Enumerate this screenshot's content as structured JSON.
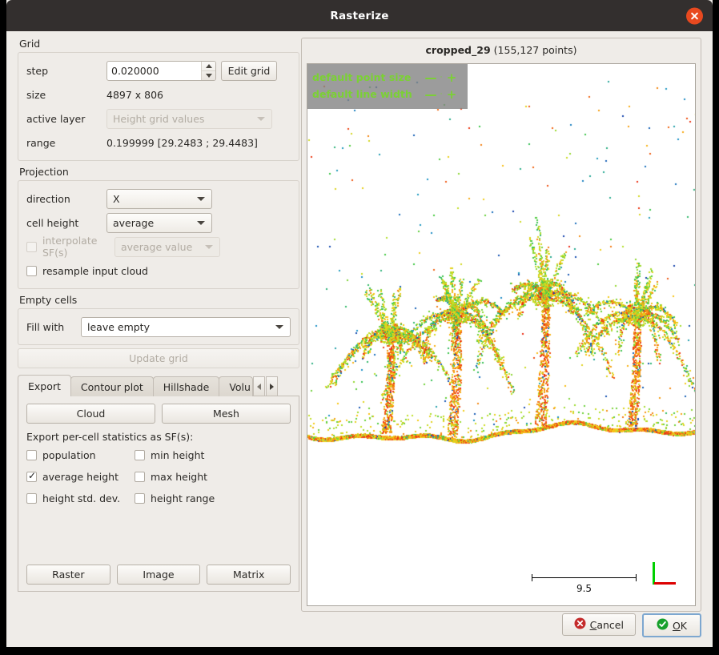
{
  "window": {
    "title": "Rasterize",
    "close_icon": "close-icon"
  },
  "grid": {
    "group_label": "Grid",
    "step_label": "step",
    "step_value": "0.020000",
    "edit_grid_label": "Edit grid",
    "size_label": "size",
    "size_value": "4897 x 806",
    "active_layer_label": "active layer",
    "active_layer_value": "Height grid values",
    "range_label": "range",
    "range_value": "0.199999 [29.2483 ; 29.4483]"
  },
  "projection": {
    "group_label": "Projection",
    "direction_label": "direction",
    "direction_value": "X",
    "cell_height_label": "cell height",
    "cell_height_value": "average",
    "interpolate_label": "interpolate SF(s)",
    "interpolate_value": "average value",
    "resample_label": "resample input cloud"
  },
  "empty_cells": {
    "group_label": "Empty cells",
    "fill_with_label": "Fill with",
    "fill_with_value": "leave empty"
  },
  "update_grid_label": "Update grid",
  "tabs": {
    "items": [
      {
        "label": "Export"
      },
      {
        "label": "Contour plot"
      },
      {
        "label": "Hillshade"
      },
      {
        "label": "Volu"
      }
    ],
    "active_index": 0,
    "scroll_left_icon": "chevron-left-icon",
    "scroll_right_icon": "chevron-right-icon"
  },
  "export_tab": {
    "cloud_label": "Cloud",
    "mesh_label": "Mesh",
    "stats_label": "Export per-cell statistics as SF(s):",
    "checkboxes": [
      {
        "label": "population",
        "checked": false
      },
      {
        "label": "min height",
        "checked": false
      },
      {
        "label": "average height",
        "checked": true
      },
      {
        "label": "max height",
        "checked": false
      },
      {
        "label": "height std. dev.",
        "checked": false
      },
      {
        "label": "height range",
        "checked": false
      }
    ],
    "bottom_buttons": [
      {
        "label": "Raster"
      },
      {
        "label": "Image"
      },
      {
        "label": "Matrix"
      }
    ]
  },
  "viewer": {
    "cloud_name": "cropped_29",
    "point_count_text": "(155,127 points)",
    "overlay": [
      {
        "label": "default point size",
        "minus": "—",
        "dot": "·",
        "plus": "+"
      },
      {
        "label": "default line width",
        "minus": "—",
        "dot": "·",
        "plus": "+"
      }
    ],
    "scale_value": "9.5",
    "axis_colors": {
      "vertical": "#00d000",
      "horizontal": "#dd0000"
    }
  },
  "footer": {
    "cancel_label_prefix": "",
    "cancel_label_underlined": "C",
    "cancel_label_rest": "ancel",
    "ok_label_underlined": "O",
    "ok_label_rest": "K"
  },
  "colors": {
    "accent_close": "#e8491f",
    "overlay_green": "#7bd134",
    "dialog_bg": "#efece8",
    "titlebar": "#332f2e"
  }
}
